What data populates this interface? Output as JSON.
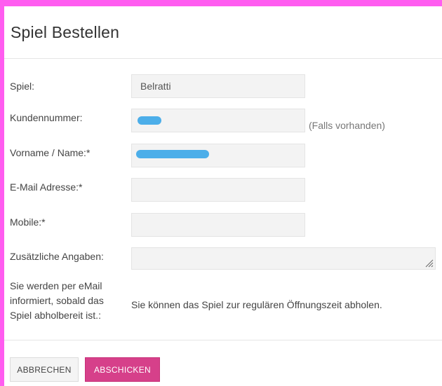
{
  "dialog": {
    "title": "Spiel Bestellen"
  },
  "form": {
    "game": {
      "label": "Spiel:",
      "value": "Belratti"
    },
    "customer_number": {
      "label": "Kundennummer:",
      "value": "",
      "hint": "(Falls vorhanden)"
    },
    "name": {
      "label": "Vorname / Name:*",
      "value": ""
    },
    "email": {
      "label": "E-Mail Adresse:*",
      "value": ""
    },
    "mobile": {
      "label": "Mobile:*",
      "value": ""
    },
    "additional": {
      "label": "Zusätzliche Angaben:",
      "value": ""
    },
    "notification": {
      "label_line1": "Sie werden per eMail",
      "label_line2": "informiert, sobald das",
      "label_line3": "Spiel abholbereit ist.:",
      "value": "Sie können das Spiel zur regulären Öffnungszeit abholen."
    }
  },
  "footer": {
    "cancel_label": "ABBRECHEN",
    "submit_label": "ABSCHICKEN"
  },
  "colors": {
    "accent": "#d6408a",
    "frame": "#ff5cf0",
    "redaction": "#3aa6e8"
  }
}
